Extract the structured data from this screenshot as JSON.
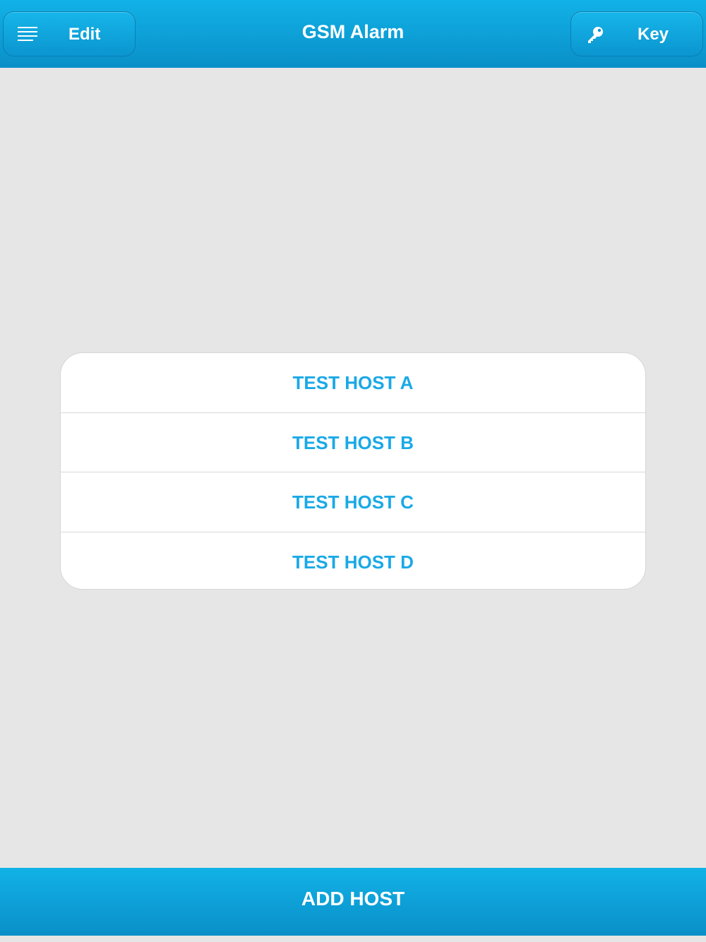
{
  "navbar": {
    "title": "GSM Alarm",
    "edit_label": "Edit",
    "key_label": "Key",
    "menu_icon": "menu-icon",
    "key_icon": "key-icon",
    "color": "#0a9fd8"
  },
  "hosts": [
    {
      "label": "TEST HOST A"
    },
    {
      "label": "TEST HOST B"
    },
    {
      "label": "TEST HOST C"
    },
    {
      "label": "TEST HOST D"
    }
  ],
  "footer": {
    "add_host_label": "ADD HOST"
  },
  "colors": {
    "accent": "#1aa9e6",
    "background": "#e6e6e6",
    "bar": "#0a9fd8"
  }
}
